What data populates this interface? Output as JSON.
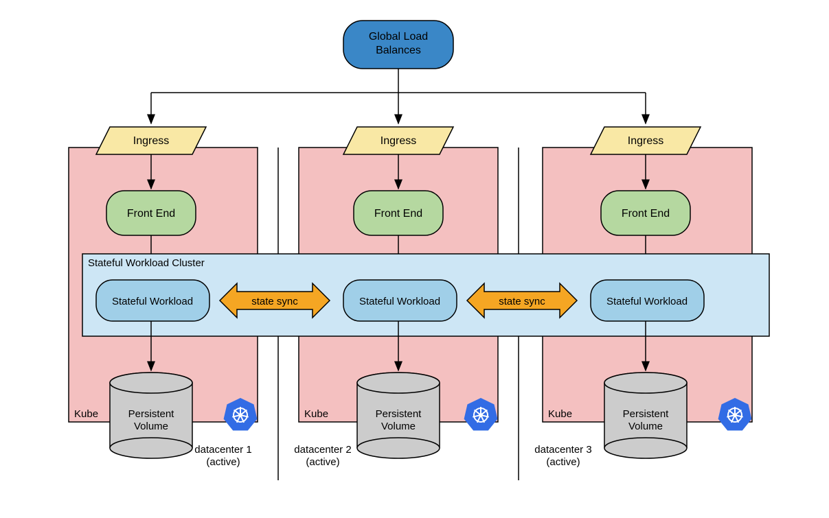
{
  "top": {
    "global_lb": "Global Load\nBalances"
  },
  "ingress_label": "Ingress",
  "frontend_label": "Front End",
  "stateful_cluster_label": "Stateful Workload Cluster",
  "stateful_workload_label": "Stateful Workload",
  "state_sync_label": "state sync",
  "kube_label": "Kube",
  "pv_label": "Persistent\nVolume",
  "datacenters": [
    "datacenter 1\n(active)",
    "datacenter 2\n(active)",
    "datacenter 3\n(active)"
  ],
  "colors": {
    "blue_node": "#3a87c7",
    "pink_box": "#f4c0c0",
    "yellow_ingress": "#f9e8a5",
    "green_fe": "#b5d8a0",
    "cluster_blue": "#cde6f5",
    "workload_blue": "#a0cfe8",
    "orange_arrow": "#f5a623",
    "grey_cyl": "#cccccc",
    "k8s_blue": "#326ce5"
  },
  "icons": {
    "k8s": "kubernetes-icon"
  }
}
